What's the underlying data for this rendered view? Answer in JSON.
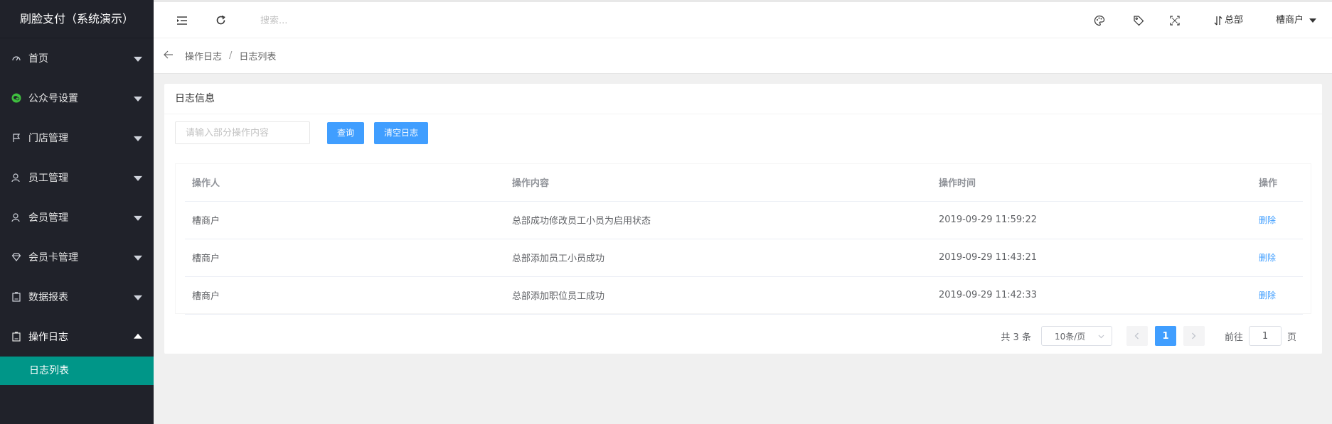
{
  "sidebar": {
    "brand": "刷脸支付（系统演示）",
    "items": [
      {
        "label": "首页",
        "icon": "dashboard-icon"
      },
      {
        "label": "公众号设置",
        "icon": "wechat-icon"
      },
      {
        "label": "门店管理",
        "icon": "flag-icon"
      },
      {
        "label": "员工管理",
        "icon": "user-icon"
      },
      {
        "label": "会员管理",
        "icon": "user-icon"
      },
      {
        "label": "会员卡管理",
        "icon": "diamond-icon"
      },
      {
        "label": "数据报表",
        "icon": "report-icon"
      },
      {
        "label": "操作日志",
        "icon": "log-icon"
      }
    ],
    "active_sub": "日志列表",
    "accent_color": "#009688"
  },
  "header": {
    "search_placeholder": "搜索...",
    "org_label": "总部",
    "user_label": "槽商户"
  },
  "breadcrumb": {
    "parent": "操作日志",
    "separator": "/",
    "current": "日志列表"
  },
  "card": {
    "title": "日志信息",
    "keyword_placeholder": "请输入部分操作内容",
    "query_button": "查询",
    "clear_button": "清空日志"
  },
  "table": {
    "headers": [
      "操作人",
      "操作内容",
      "操作时间",
      "操作"
    ],
    "rows": [
      {
        "operator": "槽商户",
        "content": "总部成功修改员工小员为启用状态",
        "time": "2019-09-29 11:59:22",
        "action": "删除"
      },
      {
        "operator": "槽商户",
        "content": "总部添加员工小员成功",
        "time": "2019-09-29 11:43:21",
        "action": "删除"
      },
      {
        "operator": "槽商户",
        "content": "总部添加职位员工成功",
        "time": "2019-09-29 11:42:33",
        "action": "删除"
      }
    ]
  },
  "pagination": {
    "total_text": "共 3 条",
    "page_size": "10条/页",
    "current_page": "1",
    "goto_label": "前往",
    "goto_value": "1",
    "page_suffix": "页"
  }
}
